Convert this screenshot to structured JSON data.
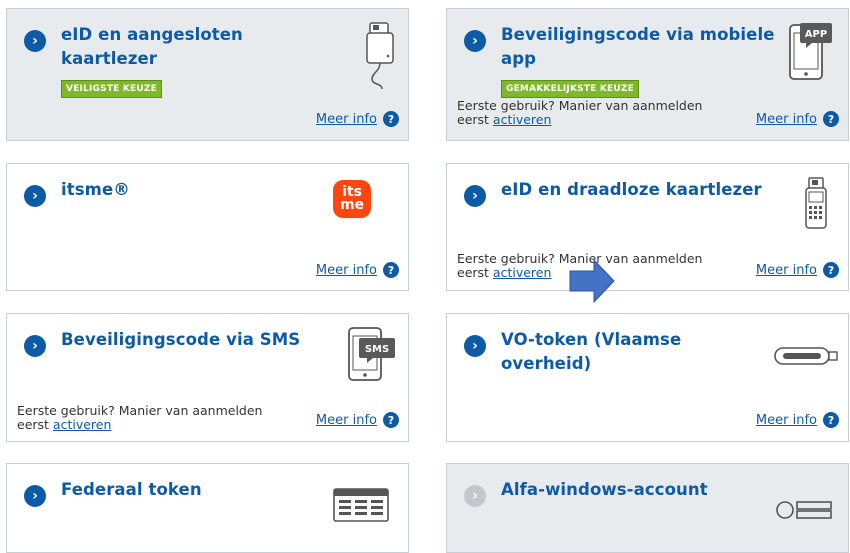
{
  "cards": {
    "eid_wired": {
      "title_line1": "eID en aangesloten",
      "title_line2": "kaartlezer",
      "badge": "VEILIGSTE KEUZE",
      "more_info": "Meer info",
      "help": "?"
    },
    "mobile_app": {
      "title_line1": "Beveiligingscode via mobiele",
      "title_line2": "app",
      "badge": "GEMAKKELIJKSTE KEUZE",
      "first_use_line1": "Eerste gebruik? Manier van aanmelden",
      "first_use_prefix": "eerst",
      "activate": "activeren",
      "more_info": "Meer info",
      "help": "?",
      "icon_text": "APP"
    },
    "itsme": {
      "title": "itsme®",
      "more_info": "Meer info",
      "help": "?",
      "logo_line1": "its",
      "logo_line2": "me"
    },
    "eid_wireless": {
      "title": "eID en draadloze kaartlezer",
      "first_use_line1": "Eerste gebruik? Manier van aanmelden",
      "first_use_prefix": "eerst",
      "activate": "activeren",
      "more_info": "Meer info",
      "help": "?"
    },
    "sms": {
      "title": "Beveiligingscode via SMS",
      "first_use_line1": "Eerste gebruik? Manier van aanmelden",
      "first_use_prefix": "eerst",
      "activate": "activeren",
      "more_info": "Meer info",
      "help": "?",
      "icon_text": "SMS"
    },
    "vo_token": {
      "title_line1": "VO-token (Vlaamse",
      "title_line2": "overheid)",
      "more_info": "Meer info",
      "help": "?"
    },
    "federal_token": {
      "title": "Federaal token"
    },
    "alfa": {
      "title": "Alfa-windows-account"
    }
  },
  "chevron": "›",
  "colors": {
    "primary_blue": "#0d5aa7",
    "badge_green": "#7db928",
    "card_grey": "#e8ebee",
    "itsme_orange": "#ff4612",
    "arrow_blue": "#4472c4"
  }
}
